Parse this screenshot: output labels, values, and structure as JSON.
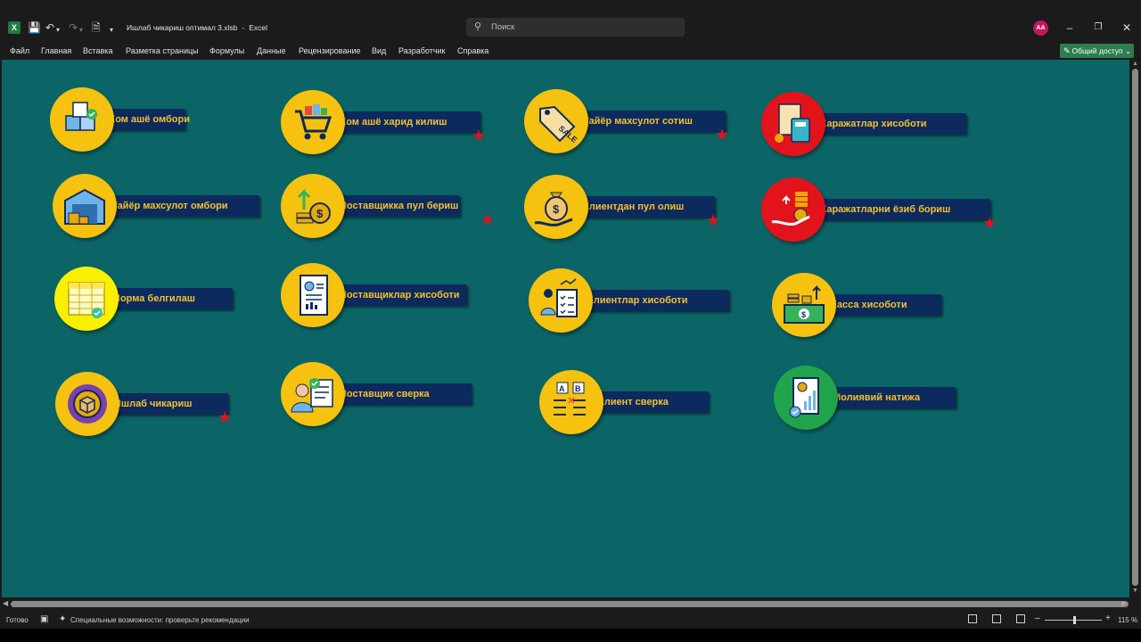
{
  "window": {
    "doc_title": "Ишлаб чикариш оптимал 3.xlsb",
    "app_name": "Excel",
    "search_placeholder": "Поиск",
    "user_initials": "AA"
  },
  "ribbon_tabs": [
    "Файл",
    "Главная",
    "Вставка",
    "Разметка страницы",
    "Формулы",
    "Данные",
    "Рецензирование",
    "Вид",
    "Разработчик",
    "Справка"
  ],
  "share_label": "Общий доступ",
  "status": {
    "ready": "Готово",
    "accessibility": "Специальные возможности: проверьте рекомендации",
    "zoom": "115 %"
  },
  "colors": {
    "sheet_bg": "#0b6466",
    "label_bg": "#0d2a5e",
    "label_text": "#f3c12e",
    "circle_yellow": "#f5c20f",
    "circle_red": "#e3131b",
    "circle_green": "#1fa44a",
    "star": "#e0121d"
  },
  "tiles": [
    {
      "label": "Хом ашё омбори",
      "icon": "boxes-icon",
      "circle": "yellow",
      "star": false
    },
    {
      "label": "Хом ашё харид килиш",
      "icon": "shopping-cart-icon",
      "circle": "yellow",
      "star": true
    },
    {
      "label": "Тайёр махсулот сотиш",
      "icon": "sale-tag-icon",
      "circle": "yellow",
      "star": true
    },
    {
      "label": "Харажатлар хисоботи",
      "icon": "calculator-receipt-icon",
      "circle": "red",
      "star": false
    },
    {
      "label": "Тайёр махсулот омбори",
      "icon": "warehouse-icon",
      "circle": "yellow",
      "star": false
    },
    {
      "label": "Поставщикка пул бериш",
      "icon": "money-up-icon",
      "circle": "yellow",
      "star": true
    },
    {
      "label": "Клиентдан пул олиш",
      "icon": "money-bag-hand-icon",
      "circle": "yellow",
      "star": true
    },
    {
      "label": "Харажатларни ёзиб бориш",
      "icon": "hand-coins-icon",
      "circle": "red",
      "star": true
    },
    {
      "label": "Норма белгилаш",
      "icon": "table-check-icon",
      "circle": "brightyellow",
      "star": false
    },
    {
      "label": "Поставщиклар хисоботи",
      "icon": "report-document-icon",
      "circle": "yellow",
      "star": false
    },
    {
      "label": "Клиентлар хисоботи",
      "icon": "client-report-icon",
      "circle": "yellow",
      "star": false
    },
    {
      "label": "Касса хисоботи",
      "icon": "cash-register-icon",
      "circle": "yellow",
      "star": false
    },
    {
      "label": "Ишлаб чикариш",
      "icon": "gear-box-icon",
      "circle": "yellow",
      "star": true
    },
    {
      "label": "Поставщик сверка",
      "icon": "supplier-check-icon",
      "circle": "yellow",
      "star": false
    },
    {
      "label": "Клиент сверка",
      "icon": "checklist-icon",
      "circle": "yellow",
      "star": false
    },
    {
      "label": "Молиявий натижа",
      "icon": "financial-result-icon",
      "circle": "green",
      "star": false
    }
  ]
}
